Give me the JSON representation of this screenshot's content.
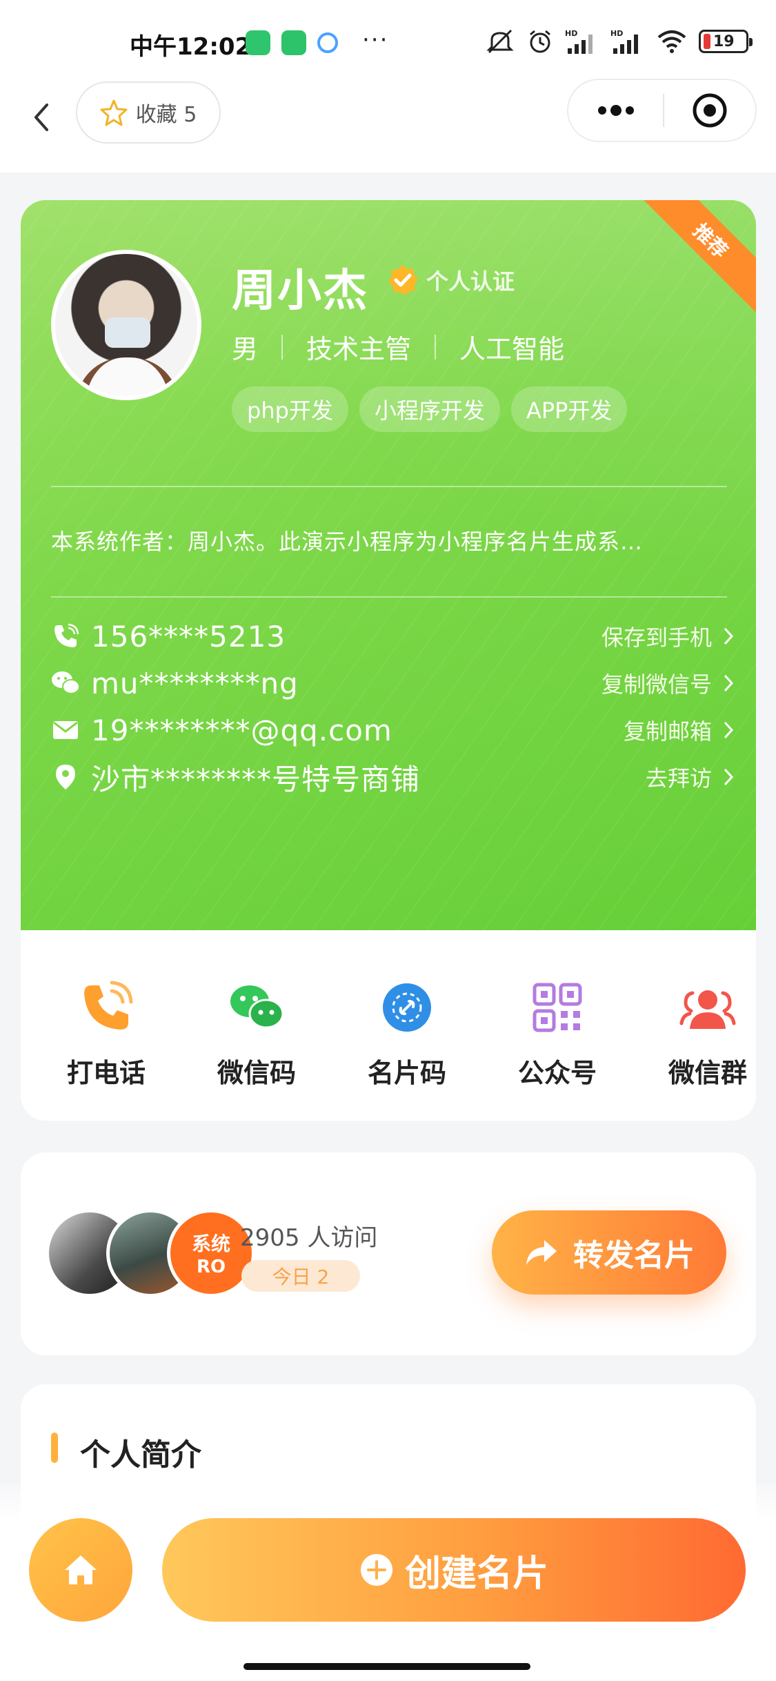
{
  "status_bar": {
    "time": "中午12:02",
    "battery": "19"
  },
  "nav": {
    "favorite_label": "收藏 5"
  },
  "profile": {
    "name": "周小杰",
    "verify_label": "个人认证",
    "badge": "推荐",
    "gender": "男",
    "title": "技术主管",
    "industry": "人工智能",
    "tags": [
      "php开发",
      "小程序开发",
      "APP开发"
    ],
    "intro": "本系统作者：周小杰。此演示小程序为小程序名片生成系…"
  },
  "contacts": [
    {
      "value": "156****5213",
      "action": "保存到手机",
      "icon": "phone-icon"
    },
    {
      "value": "mu********ng",
      "action": "复制微信号",
      "icon": "wechat-icon"
    },
    {
      "value": "19********@qq.com",
      "action": "复制邮箱",
      "icon": "mail-icon"
    },
    {
      "value": "沙市********号特号商铺",
      "action": "去拜访",
      "icon": "location-icon"
    }
  ],
  "actions": [
    {
      "label": "打电话",
      "icon": "call-icon",
      "color": "#ff9f2e"
    },
    {
      "label": "微信码",
      "icon": "wechat-qr-icon",
      "color": "#34c759"
    },
    {
      "label": "名片码",
      "icon": "card-code-icon",
      "color": "#2f8fe6"
    },
    {
      "label": "公众号",
      "icon": "official-account-icon",
      "color": "#b57be0"
    },
    {
      "label": "微信群",
      "icon": "group-icon",
      "color": "#f2554a"
    }
  ],
  "visitors": {
    "count_label": "2905 人访问",
    "today_label": "今日 2",
    "avatar3_text": "系统",
    "avatar3_subtext": "RO"
  },
  "share": {
    "label": "转发名片"
  },
  "section": {
    "title": "个人简介"
  },
  "bottom": {
    "create_label": "创建名片"
  },
  "colors": {
    "card_green": "#7fd84a",
    "accent_orange": "#ff9d3f"
  }
}
